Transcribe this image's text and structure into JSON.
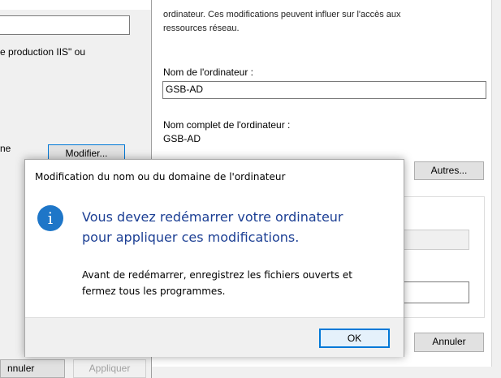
{
  "bg_left": {
    "text_iis": "e production IIS\" ou",
    "label_ne": "ne",
    "modify_button": "Modifier...",
    "annuler_button": "nnuler",
    "appliquer_button": "Appliquer"
  },
  "bg_right": {
    "warning_line1": "ordinateur. Ces modifications peuvent influer sur l'accès aux",
    "warning_line2": "ressources réseau.",
    "computer_name_label": "Nom de l'ordinateur :",
    "computer_name_value": "GSB-AD",
    "full_name_label": "Nom complet de l'ordinateur :",
    "full_name_value": "GSB-AD",
    "others_button": "Autres...",
    "annuler_button": "Annuler"
  },
  "dialog": {
    "title": "Modification du nom ou du domaine de l'ordinateur",
    "icon": "info-icon",
    "main_line1": "Vous devez redémarrer votre ordinateur",
    "main_line2": "pour appliquer ces modifications.",
    "sub_line1": "Avant de redémarrer, enregistrez les fichiers ouverts et",
    "sub_line2": "fermez tous les programmes.",
    "ok_button": "OK",
    "accent_color": "#1c3f94",
    "icon_color": "#1e76c8"
  }
}
